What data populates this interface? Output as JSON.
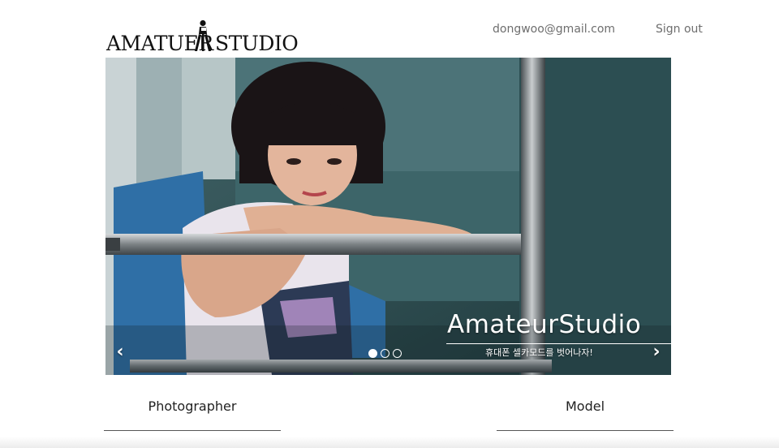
{
  "header": {
    "logo": {
      "left": "AMATUER",
      "right": "STUDIO",
      "icon": "photographer-tripod-icon"
    },
    "user_email": "dongwoo@gmail.com",
    "signout_label": "Sign out"
  },
  "carousel": {
    "title": "AmateurStudio",
    "subtitle": "휴대폰 셀카모드를 벗어나자!",
    "prev_icon": "‹",
    "next_icon": "›",
    "slide_count": 3,
    "active_slide": 1
  },
  "categories": [
    {
      "label": "Photographer"
    },
    {
      "label": "Model"
    }
  ],
  "colors": {
    "link_gray": "#6e6e6e",
    "text_dark": "#222222",
    "slide_teal": "#2e5a5c"
  }
}
